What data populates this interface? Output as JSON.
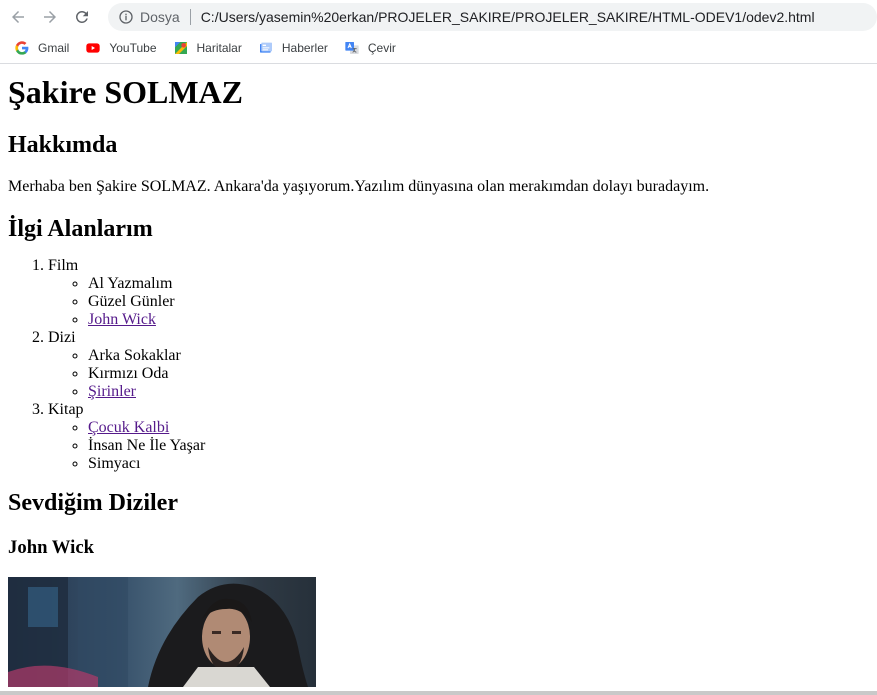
{
  "browser": {
    "secure_label": "Dosya",
    "url": "C:/Users/yasemin%20erkan/PROJELER_SAKIRE/PROJELER_SAKIRE/HTML-ODEV1/odev2.html",
    "bookmarks": [
      {
        "label": "Gmail",
        "icon": "google-icon"
      },
      {
        "label": "YouTube",
        "icon": "youtube-icon"
      },
      {
        "label": "Haritalar",
        "icon": "maps-icon"
      },
      {
        "label": "Haberler",
        "icon": "news-icon"
      },
      {
        "label": "Çevir",
        "icon": "translate-icon"
      }
    ]
  },
  "page": {
    "title": "Şakire SOLMAZ",
    "about_heading": "Hakkımda",
    "about_text": "Merhaba ben Şakire SOLMAZ. Ankara'da yaşıyorum.Yazılım dünyasına olan merakımdan dolayı buradayım.",
    "interests_heading": "İlgi Alanlarım",
    "interests": [
      {
        "label": "Film",
        "items": [
          {
            "text": "Al Yazmalım",
            "link": false
          },
          {
            "text": "Güzel Günler",
            "link": false
          },
          {
            "text": "John Wick",
            "link": true
          }
        ]
      },
      {
        "label": "Dizi",
        "items": [
          {
            "text": "Arka Sokaklar",
            "link": false
          },
          {
            "text": "Kırmızı Oda",
            "link": false
          },
          {
            "text": "Şirinler",
            "link": true
          }
        ]
      },
      {
        "label": "Kitap",
        "items": [
          {
            "text": "Çocuk Kalbi",
            "link": true
          },
          {
            "text": "İnsan Ne İle Yaşar",
            "link": false
          },
          {
            "text": "Simyacı",
            "link": false
          }
        ]
      }
    ],
    "favorites_heading": "Sevdiğim Diziler",
    "show_heading": "John Wick"
  }
}
